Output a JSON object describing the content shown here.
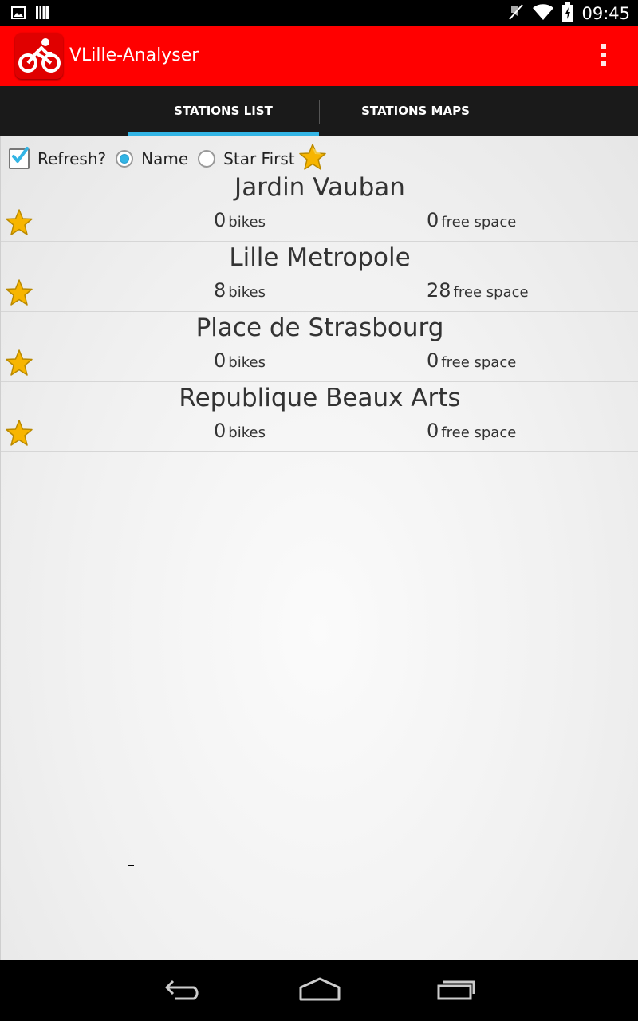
{
  "status_bar": {
    "time": "09:45",
    "icons": [
      "image-icon",
      "barcode-icon",
      "mute-icon",
      "wifi-icon",
      "battery-icon"
    ]
  },
  "app": {
    "title": "VLille-Analyser",
    "icon": "bike-icon",
    "brand_color": "#ff0000"
  },
  "tabs": [
    {
      "label": "STATIONS LIST",
      "active": true
    },
    {
      "label": "STATIONS MAPS",
      "active": false
    }
  ],
  "filters": {
    "refresh_label": "Refresh?",
    "refresh_checked": true,
    "name_label": "Name",
    "name_selected": true,
    "star_first_label": "Star First",
    "star_first_selected": false
  },
  "stations": [
    {
      "name": "Jardin Vauban",
      "bikes": "0",
      "bikes_unit": "bikes",
      "free": "0",
      "free_unit": "free space"
    },
    {
      "name": "Lille Metropole",
      "bikes": "8",
      "bikes_unit": "bikes",
      "free": "28",
      "free_unit": "free space"
    },
    {
      "name": "Place de Strasbourg",
      "bikes": "0",
      "bikes_unit": "bikes",
      "free": "0",
      "free_unit": "free space"
    },
    {
      "name": "Republique Beaux Arts",
      "bikes": "0",
      "bikes_unit": "bikes",
      "free": "0",
      "free_unit": "free space"
    }
  ],
  "nav": [
    "back-icon",
    "home-icon",
    "recents-icon"
  ],
  "colors": {
    "accent": "#33b5e5",
    "star": "#f7b500"
  }
}
